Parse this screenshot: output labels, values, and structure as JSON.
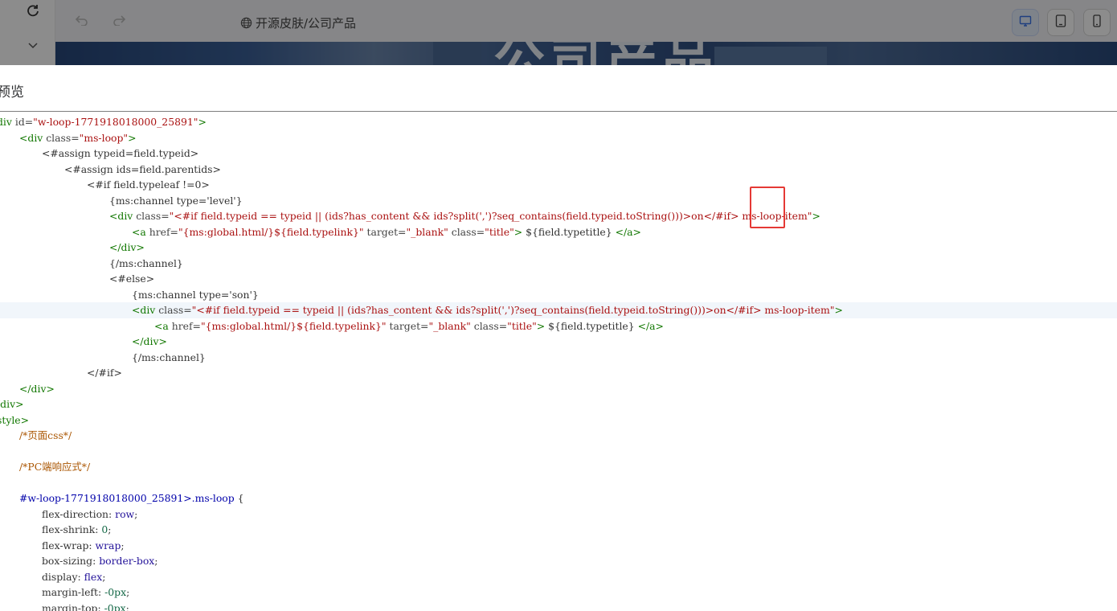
{
  "background": {
    "url_text": "开源皮肤/公司产品",
    "banner_text": "公司产品"
  },
  "dialog": {
    "title": "预览"
  },
  "code_lines": [
    {
      "indent": 0,
      "hl": false,
      "parts": [
        [
          "tag",
          "div"
        ],
        [
          "text",
          " "
        ],
        [
          "attr",
          "id="
        ],
        [
          "str",
          "\"w-loop-1771918018000_25891\""
        ],
        [
          "tag",
          ">"
        ]
      ]
    },
    {
      "indent": 1,
      "hl": false,
      "parts": [
        [
          "tag",
          "<div"
        ],
        [
          "text",
          " "
        ],
        [
          "attr",
          "class="
        ],
        [
          "str",
          "\"ms-loop\""
        ],
        [
          "tag",
          ">"
        ]
      ]
    },
    {
      "indent": 2,
      "hl": false,
      "parts": [
        [
          "text",
          "<#assign typeid=field.typeid>"
        ]
      ]
    },
    {
      "indent": 3,
      "hl": false,
      "parts": [
        [
          "text",
          "<#assign ids=field.parentids>"
        ]
      ]
    },
    {
      "indent": 4,
      "hl": false,
      "parts": [
        [
          "text",
          "<#if field.typeleaf !=0>"
        ]
      ]
    },
    {
      "indent": 5,
      "hl": false,
      "parts": [
        [
          "text",
          "{ms:channel type='level'}"
        ]
      ]
    },
    {
      "indent": 5,
      "hl": false,
      "parts": [
        [
          "tag",
          "<div"
        ],
        [
          "text",
          " "
        ],
        [
          "attr",
          "class="
        ],
        [
          "str",
          "\"<#if field.typeid == typeid || (ids?has_content && ids?split(',')?seq_contains(field.typeid.toString()))>on</#if> ms-loop-item\""
        ],
        [
          "tag",
          ">"
        ]
      ]
    },
    {
      "indent": 6,
      "hl": false,
      "parts": [
        [
          "tag",
          "<a"
        ],
        [
          "text",
          " "
        ],
        [
          "attr",
          "href="
        ],
        [
          "str",
          "\"{ms:global.html/}${field.typelink}\""
        ],
        [
          "text",
          " "
        ],
        [
          "attr",
          "target="
        ],
        [
          "str",
          "\"_blank\""
        ],
        [
          "text",
          " "
        ],
        [
          "attr",
          "class="
        ],
        [
          "str",
          "\"title\""
        ],
        [
          "tag",
          ">"
        ],
        [
          "text",
          " ${field.typetitle} "
        ],
        [
          "tag",
          "</a>"
        ]
      ]
    },
    {
      "indent": 5,
      "hl": false,
      "parts": [
        [
          "tag",
          "</div>"
        ]
      ]
    },
    {
      "indent": 5,
      "hl": false,
      "parts": [
        [
          "text",
          "{/ms:channel}"
        ]
      ]
    },
    {
      "indent": 5,
      "hl": false,
      "parts": [
        [
          "text",
          "<#else>"
        ]
      ]
    },
    {
      "indent": 6,
      "hl": false,
      "parts": [
        [
          "text",
          "{ms:channel type='son'}"
        ]
      ]
    },
    {
      "indent": 6,
      "hl": true,
      "parts": [
        [
          "tag",
          "<div"
        ],
        [
          "text",
          " "
        ],
        [
          "attr",
          "class="
        ],
        [
          "str",
          "\"<#if field.typeid == typeid || (ids?has_content && ids?split(',')?seq_contains(field.typeid.toString()))>on</#if> ms-loop-item\""
        ],
        [
          "tag",
          ">"
        ]
      ]
    },
    {
      "indent": 7,
      "hl": false,
      "parts": [
        [
          "tag",
          "<a"
        ],
        [
          "text",
          " "
        ],
        [
          "attr",
          "href="
        ],
        [
          "str",
          "\"{ms:global.html/}${field.typelink}\""
        ],
        [
          "text",
          " "
        ],
        [
          "attr",
          "target="
        ],
        [
          "str",
          "\"_blank\""
        ],
        [
          "text",
          " "
        ],
        [
          "attr",
          "class="
        ],
        [
          "str",
          "\"title\""
        ],
        [
          "tag",
          ">"
        ],
        [
          "text",
          " ${field.typetitle} "
        ],
        [
          "tag",
          "</a>"
        ]
      ]
    },
    {
      "indent": 6,
      "hl": false,
      "parts": [
        [
          "tag",
          "</div>"
        ]
      ]
    },
    {
      "indent": 6,
      "hl": false,
      "parts": [
        [
          "text",
          "{/ms:channel}"
        ]
      ]
    },
    {
      "indent": 4,
      "hl": false,
      "parts": [
        [
          "text",
          "</#if>"
        ]
      ]
    },
    {
      "indent": 1,
      "hl": false,
      "parts": [
        [
          "tag",
          "</div>"
        ]
      ]
    },
    {
      "indent": 0,
      "hl": false,
      "parts": [
        [
          "tag",
          "/div>"
        ]
      ]
    },
    {
      "indent": 0,
      "hl": false,
      "parts": [
        [
          "tag",
          "style>"
        ]
      ]
    },
    {
      "indent": 1,
      "hl": false,
      "parts": [
        [
          "cmt",
          "/*页面css*/"
        ]
      ]
    },
    {
      "indent": 0,
      "hl": false,
      "parts": [
        [
          "text",
          ""
        ]
      ]
    },
    {
      "indent": 1,
      "hl": false,
      "parts": [
        [
          "cmt",
          "/*PC端响应式*/"
        ]
      ]
    },
    {
      "indent": 0,
      "hl": false,
      "parts": [
        [
          "text",
          ""
        ]
      ]
    },
    {
      "indent": 1,
      "hl": false,
      "parts": [
        [
          "sel",
          "#w-loop-1771918018000_25891>.ms-loop"
        ],
        [
          "text",
          " {"
        ]
      ]
    },
    {
      "indent": 2,
      "hl": false,
      "parts": [
        [
          "prop",
          "flex-direction"
        ],
        [
          "text",
          ": "
        ],
        [
          "val",
          "row"
        ],
        [
          "text",
          ";"
        ]
      ]
    },
    {
      "indent": 2,
      "hl": false,
      "parts": [
        [
          "prop",
          "flex-shrink"
        ],
        [
          "text",
          ": "
        ],
        [
          "num",
          "0"
        ],
        [
          "text",
          ";"
        ]
      ]
    },
    {
      "indent": 2,
      "hl": false,
      "parts": [
        [
          "prop",
          "flex-wrap"
        ],
        [
          "text",
          ": "
        ],
        [
          "val",
          "wrap"
        ],
        [
          "text",
          ";"
        ]
      ]
    },
    {
      "indent": 2,
      "hl": false,
      "parts": [
        [
          "prop",
          "box-sizing"
        ],
        [
          "text",
          ": "
        ],
        [
          "val",
          "border-box"
        ],
        [
          "text",
          ";"
        ]
      ]
    },
    {
      "indent": 2,
      "hl": false,
      "parts": [
        [
          "prop",
          "display"
        ],
        [
          "text",
          ": "
        ],
        [
          "val",
          "flex"
        ],
        [
          "text",
          ";"
        ]
      ]
    },
    {
      "indent": 2,
      "hl": false,
      "parts": [
        [
          "prop",
          "margin-left"
        ],
        [
          "text",
          ": "
        ],
        [
          "num",
          "-0px"
        ],
        [
          "text",
          ";"
        ]
      ]
    },
    {
      "indent": 2,
      "hl": false,
      "parts": [
        [
          "prop",
          "margin-top"
        ],
        [
          "text",
          ": "
        ],
        [
          "num",
          "-0px"
        ],
        [
          "text",
          ";"
        ]
      ]
    }
  ]
}
